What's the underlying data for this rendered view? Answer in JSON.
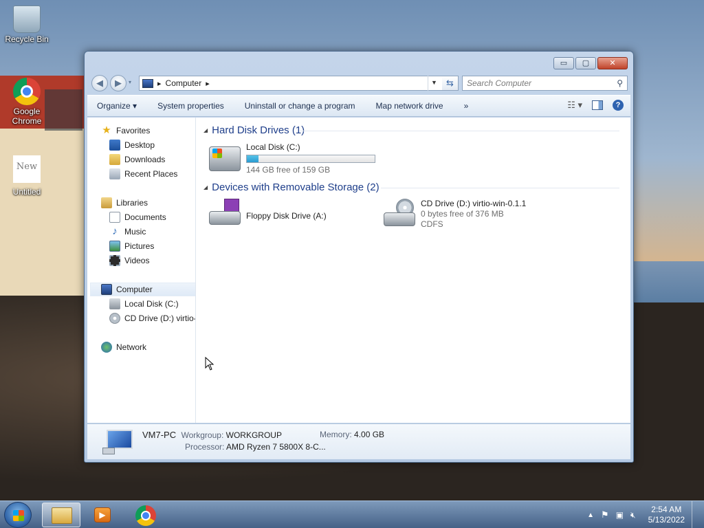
{
  "desktop": {
    "icons": [
      {
        "label": "Recycle Bin"
      },
      {
        "label": "Google Chrome"
      },
      {
        "label": "Untitled",
        "thumb_text": "New"
      }
    ]
  },
  "window": {
    "caption_buttons": {
      "minimize": "▭",
      "maximize": "▢",
      "close": "✕"
    },
    "address": {
      "root_arrow": "▸",
      "crumb": "Computer",
      "crumb_arrow": "▸"
    },
    "search_placeholder": "Search Computer",
    "toolbar": {
      "organize": "Organize ▾",
      "system_properties": "System properties",
      "uninstall": "Uninstall or change a program",
      "map_drive": "Map network drive",
      "more": "»"
    },
    "nav": {
      "favorites": "Favorites",
      "desktop": "Desktop",
      "downloads": "Downloads",
      "recent": "Recent Places",
      "libraries": "Libraries",
      "documents": "Documents",
      "music": "Music",
      "pictures": "Pictures",
      "videos": "Videos",
      "computer": "Computer",
      "local_disk": "Local Disk (C:)",
      "cd_drive": "CD Drive (D:) virtio-w",
      "network": "Network"
    },
    "groups": {
      "hard_disks": "Hard Disk Drives (1)",
      "removable": "Devices with Removable Storage (2)"
    },
    "drives": {
      "c": {
        "name": "Local Disk (C:)",
        "free": "144 GB free of 159 GB",
        "used_fraction": 0.094
      },
      "a": {
        "name": "Floppy Disk Drive (A:)"
      },
      "d": {
        "name": "CD Drive (D:) virtio-win-0.1.1",
        "free": "0 bytes free of 376 MB",
        "fs": "CDFS"
      }
    },
    "details": {
      "pc_name": "VM7-PC",
      "workgroup_label": "Workgroup:",
      "workgroup": "WORKGROUP",
      "memory_label": "Memory:",
      "memory": "4.00 GB",
      "processor_label": "Processor:",
      "processor": "AMD Ryzen 7 5800X 8-C..."
    }
  },
  "taskbar": {
    "clock_time": "2:54 AM",
    "clock_date": "5/13/2022"
  }
}
